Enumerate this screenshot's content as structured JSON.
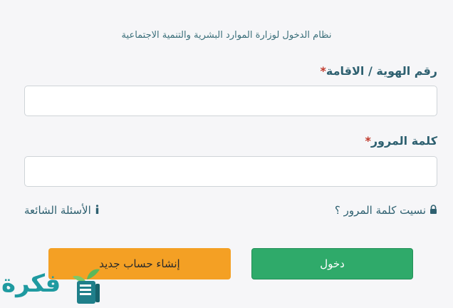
{
  "header": {
    "subtitle": "نظام الدخول لوزارة الموارد البشرية والتنمية الاجتماعية"
  },
  "form": {
    "id_label": "رقم الهوية / الاقامة",
    "id_required_mark": "*",
    "id_value": "",
    "password_label": "كلمة المرور",
    "password_required_mark": "*",
    "password_value": ""
  },
  "links": {
    "forgot_password": "نسيت كلمة المرور ؟",
    "faq": "الأسئلة الشائعة"
  },
  "buttons": {
    "login": "دخول",
    "create_account": "إنشاء حساب جديد"
  },
  "watermark": {
    "text": "فكرة"
  },
  "colors": {
    "login_button": "#2faa6a",
    "create_button": "#f4a024",
    "required_mark": "#c0392b",
    "label_text": "#2e6070"
  },
  "icons": {
    "forgot_password": "lock-icon",
    "faq": "info-icon"
  }
}
